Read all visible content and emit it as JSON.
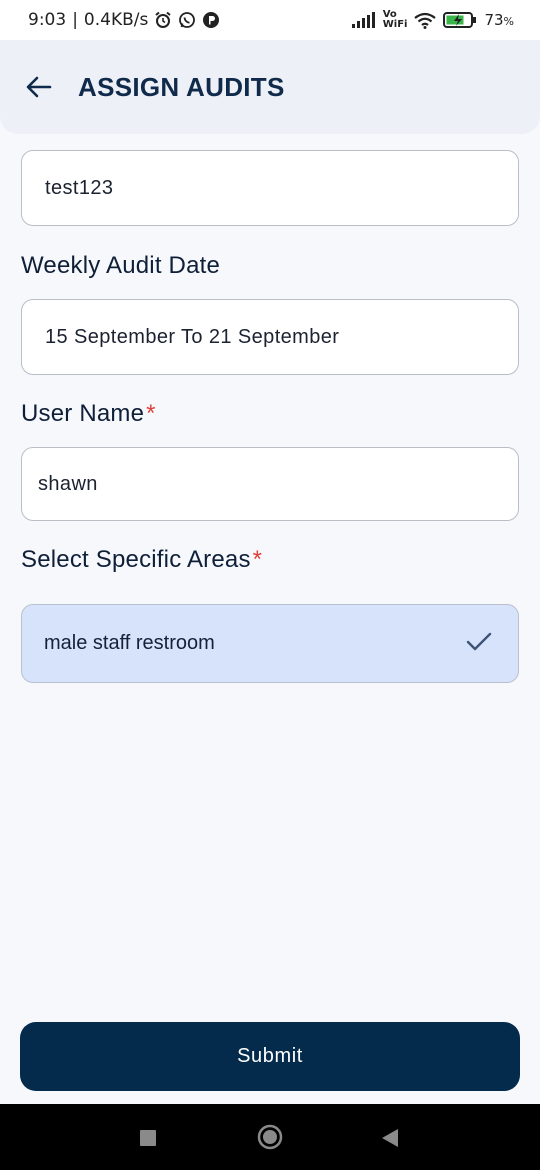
{
  "status_bar": {
    "time": "9:03",
    "separator": "|",
    "net_speed": "0.4KB/s",
    "network_label_top": "Vo",
    "network_label_bottom": "WiFi",
    "battery_percent": "73",
    "battery_unit": "%",
    "icons": [
      "alarm-icon",
      "whatsapp-icon",
      "app-notification-icon",
      "signal-icon",
      "wifi-icon",
      "battery-charging-icon"
    ]
  },
  "header": {
    "back_icon": "arrow-left-icon",
    "title": "ASSIGN AUDITS"
  },
  "form": {
    "audit_name_value": "test123",
    "weekly_audit_date": {
      "label": "Weekly Audit Date",
      "value": "15 September To 21 September"
    },
    "user_name": {
      "label": "User Name",
      "required_mark": "*",
      "value": "shawn"
    },
    "specific_areas": {
      "label": "Select Specific Areas",
      "required_mark": "*",
      "selected_item": "male staff restroom",
      "selected_icon": "checkmark-icon"
    }
  },
  "submit_label": "Submit",
  "colors": {
    "header_bg": "#edf0f6",
    "page_bg": "#f6f8fc",
    "title": "#0f2a4a",
    "submit_bg": "#042b4c",
    "required": "#e0403a",
    "selected_chip_bg": "#d6e3fb"
  },
  "nav_bar": {
    "icons": [
      "recent-apps-square-icon",
      "home-circle-icon",
      "back-triangle-icon"
    ]
  }
}
